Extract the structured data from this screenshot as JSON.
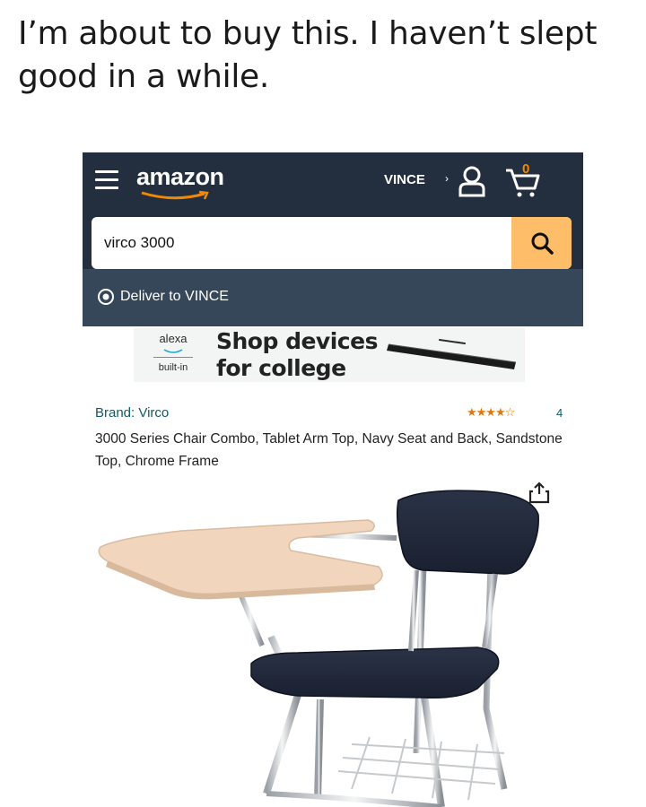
{
  "caption": "I’m about to buy this. I haven’t slept good in a while.",
  "header": {
    "logo_text": "amazon",
    "account_label": "VINCE",
    "cart_count": "0"
  },
  "search": {
    "value": "virco 3000"
  },
  "delivery": {
    "label": "Deliver to VINCE"
  },
  "ad": {
    "alexa": "alexa",
    "built_in": "built-in",
    "headline": "Shop devices for college"
  },
  "product": {
    "brand": "Brand: Virco",
    "rating_stars": "★★★★☆",
    "rating_count": "4",
    "title": "3000 Series Chair Combo, Tablet Arm Top, Navy Seat and Back, Sandstone Top, Chrome Frame"
  },
  "colors": {
    "header_bg": "#232f3e",
    "deliver_bg": "#37475a",
    "search_button": "#febd69",
    "link_teal": "#0f5a63",
    "star_orange": "#e07a10"
  }
}
